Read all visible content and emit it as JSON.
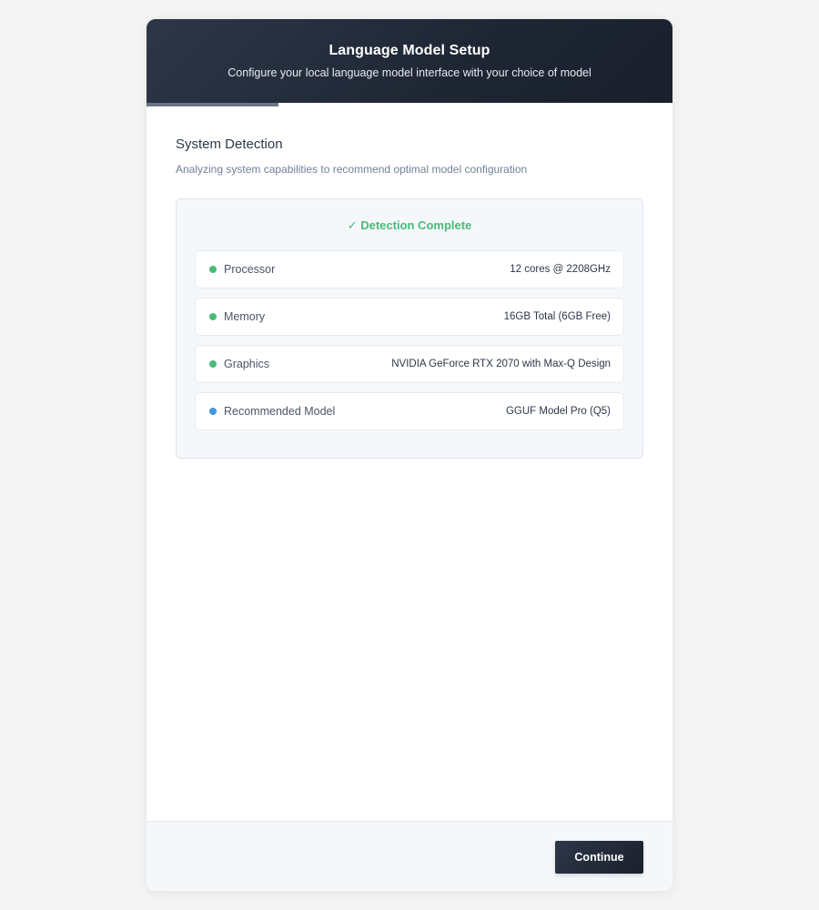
{
  "header": {
    "title": "Language Model Setup",
    "subtitle": "Configure your local language model interface with your choice of model"
  },
  "progress": {
    "fraction": 0.25,
    "color": "#6b7484"
  },
  "section": {
    "title": "System Detection",
    "description": "Analyzing system capabilities to recommend optimal model configuration"
  },
  "detection": {
    "status": "✓ Detection Complete",
    "status_color": "#48bb78",
    "items": [
      {
        "label": "Processor",
        "value": "12 cores @ 2208GHz",
        "dot_color": "#48bb78"
      },
      {
        "label": "Memory",
        "value": "16GB Total (6GB Free)",
        "dot_color": "#48bb78"
      },
      {
        "label": "Graphics",
        "value": "NVIDIA GeForce RTX 2070 with Max-Q Design",
        "dot_color": "#48bb78"
      },
      {
        "label": "Recommended Model",
        "value": "GGUF Model Pro (Q5)",
        "dot_color": "#4299e1"
      }
    ]
  },
  "footer": {
    "continue_label": "Continue"
  }
}
